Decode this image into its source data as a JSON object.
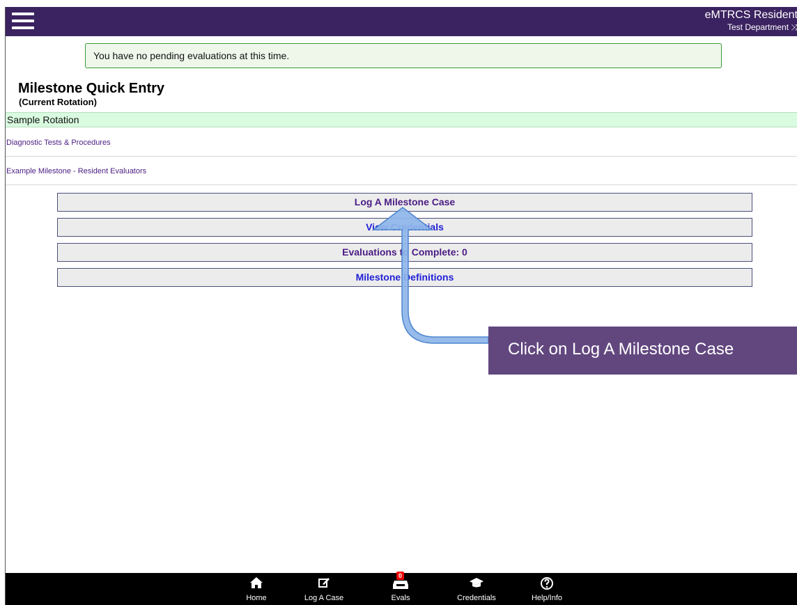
{
  "header": {
    "app_title": "eMTRCS Resident",
    "department": "Test Department",
    "switch_glyph": "⤨",
    "menu_icon": "hamburger-icon"
  },
  "notice": {
    "text": "You have no pending evaluations at this time."
  },
  "page": {
    "title": "Milestone Quick Entry",
    "subtitle": "(Current Rotation)"
  },
  "rotation": {
    "name": "Sample Rotation"
  },
  "milestones": [
    {
      "label": "Diagnostic Tests & Procedures"
    },
    {
      "label": "Example Milestone - Resident Evaluators"
    }
  ],
  "buttons": {
    "log_case": "Log A Milestone Case",
    "view_credentials": "View Credentials",
    "evaluations": "Evaluations to Complete: 0",
    "definitions": "Milestone Definitions"
  },
  "callout": {
    "text": "Click on Log A Milestone Case"
  },
  "tabbar": {
    "home": "Home",
    "log_case": "Log A Case",
    "evals": "Evals",
    "evals_badge": "0",
    "credentials": "Credentials",
    "help": "Help/Info"
  },
  "colors": {
    "header": "#3b2260",
    "callout": "#62477f",
    "rotation_bar": "#d9fbe0",
    "link_purple": "#4a1c82",
    "link_blue": "#1f1fd6",
    "arrow": "#8fb6ea"
  }
}
